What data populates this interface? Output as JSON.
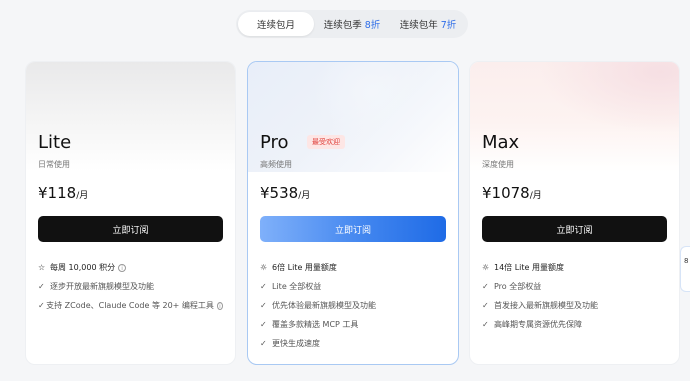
{
  "tabs": [
    {
      "label": "连续包月",
      "discount": ""
    },
    {
      "label": "连续包季",
      "discount": "8折"
    },
    {
      "label": "连续包年",
      "discount": "7折"
    }
  ],
  "plans": {
    "lite": {
      "name": "Lite",
      "usage": "日常使用",
      "price": "¥118",
      "per": "/月",
      "button": "立即订阅",
      "features": [
        {
          "icon": "star-icon",
          "glyph": "☆",
          "text": "每周 10,000 积分",
          "info": true,
          "head": true
        },
        {
          "icon": "check-icon",
          "glyph": "✓",
          "text": "逐步开放最新旗舰模型及功能"
        },
        {
          "icon": "check-icon",
          "glyph": "✓",
          "text": "支持 ZCode、Claude Code 等 20+ 编程工具",
          "info": true
        }
      ]
    },
    "pro": {
      "name": "Pro",
      "badge": "最受欢迎",
      "usage": "高频使用",
      "price": "¥538",
      "per": "/月",
      "button": "立即订阅",
      "features": [
        {
          "icon": "gear-icon",
          "glyph": "☼",
          "text": "6倍 Lite 用量额度",
          "head": true
        },
        {
          "icon": "check-icon",
          "glyph": "✓",
          "text": "Lite 全部权益"
        },
        {
          "icon": "check-icon",
          "glyph": "✓",
          "text": "优先体验最新旗舰模型及功能"
        },
        {
          "icon": "check-icon",
          "glyph": "✓",
          "text": "覆盖多款精选 MCP 工具"
        },
        {
          "icon": "check-icon",
          "glyph": "✓",
          "text": "更快生成速度"
        }
      ]
    },
    "max": {
      "name": "Max",
      "usage": "深度使用",
      "price": "¥1078",
      "per": "/月",
      "button": "立即订阅",
      "features": [
        {
          "icon": "gear-icon",
          "glyph": "☼",
          "text": "14倍 Lite 用量额度",
          "head": true
        },
        {
          "icon": "check-icon",
          "glyph": "✓",
          "text": "Pro 全部权益"
        },
        {
          "icon": "check-icon",
          "glyph": "✓",
          "text": "首发接入最新旗舰模型及功能"
        },
        {
          "icon": "check-icon",
          "glyph": "✓",
          "text": "高峰期专属资源优先保障"
        }
      ]
    }
  },
  "side_tab": {
    "label": "8"
  },
  "colors": {
    "accent": "#2f6ee8",
    "badge_red": "#e0403b",
    "button_dark": "#111111"
  }
}
